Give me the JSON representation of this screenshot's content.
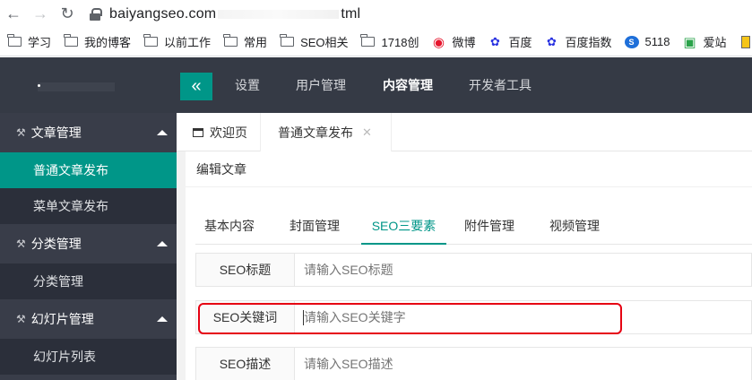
{
  "browser": {
    "url_visible_start": "baiyangseo.com",
    "url_visible_end": "tml",
    "bookmarks": [
      {
        "label": "学习",
        "icon": "folder-icon"
      },
      {
        "label": "我的博客",
        "icon": "folder-icon"
      },
      {
        "label": "以前工作",
        "icon": "folder-icon"
      },
      {
        "label": "常用",
        "icon": "folder-icon"
      },
      {
        "label": "SEO相关",
        "icon": "folder-icon"
      },
      {
        "label": "1718创",
        "icon": "folder-icon"
      },
      {
        "label": "微博",
        "icon": "weibo-icon"
      },
      {
        "label": "百度",
        "icon": "baidu-paw-icon"
      },
      {
        "label": "百度指数",
        "icon": "baidu-paw-icon"
      },
      {
        "label": "5118",
        "icon": "5118-icon"
      },
      {
        "label": "爱站",
        "icon": "aizhan-icon"
      }
    ]
  },
  "header": {
    "nav": [
      "设置",
      "用户管理",
      "内容管理",
      "开发者工具"
    ],
    "active_nav": "内容管理",
    "accent": "#009688"
  },
  "sidebar": {
    "groups": [
      {
        "label": "文章管理",
        "items": [
          "普通文章发布",
          "菜单文章发布"
        ]
      },
      {
        "label": "分类管理",
        "items": [
          "分类管理"
        ]
      },
      {
        "label": "幻灯片管理",
        "items": [
          "幻灯片列表"
        ]
      }
    ],
    "active_item": "普通文章发布"
  },
  "tabs": {
    "welcome": "欢迎页",
    "current": "普通文章发布"
  },
  "card": {
    "title": "编辑文章",
    "subtabs": [
      "基本内容",
      "封面管理",
      "SEO三要素",
      "附件管理",
      "视频管理"
    ],
    "active_subtab": "SEO三要素"
  },
  "form": {
    "title": {
      "label": "SEO标题",
      "placeholder": "请输入SEO标题",
      "value": ""
    },
    "keywords": {
      "label": "SEO关键词",
      "placeholder": "请输入SEO关键字",
      "value": ""
    },
    "description": {
      "label": "SEO描述",
      "placeholder": "请输入SEO描述",
      "value": ""
    }
  },
  "colors": {
    "highlight": "#e60012",
    "header_bg": "#353a45",
    "sidebar_bg": "#393d49"
  }
}
